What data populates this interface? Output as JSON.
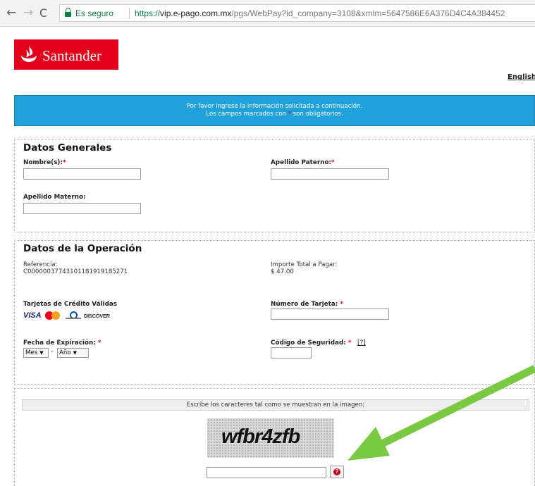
{
  "browser": {
    "secure_label": "Es seguro",
    "url_scheme": "https://",
    "url_host": "vip.e-pago.com.mx",
    "url_path": "/pgs/WebPay?id_company=3108&xmlm=5647586E6A376D4C4A384452"
  },
  "header": {
    "brand": "Santander",
    "language_link": "English"
  },
  "banner": {
    "line1": "Por favor ingrese la información solicitada a continuación.",
    "line2_before": "Los campos marcados con ",
    "line2_star": "*",
    "line2_after": " son obligatorios."
  },
  "general": {
    "title": "Datos Generales",
    "first_name_label": "Nombre(s):",
    "paternal_label": "Apellido Paterno:",
    "maternal_label": "Apellido Materno:",
    "required_mark": "*"
  },
  "operation": {
    "title": "Datos de la Operación",
    "reference_label": "Referencia:",
    "reference_value": "C0000003774310118191918527​1",
    "total_label": "Importe Total a Pagar:",
    "total_value": "$ 47.00",
    "cards_label": "Tarjetas de Crédito Válidas",
    "card_number_label": "Número de Tarjeta:",
    "expiry_label": "Fecha de Expiración:",
    "security_label": "Código de Seguridad:",
    "help_link": "[?]",
    "month_select": "Mes",
    "year_select": "Año",
    "separator": "-",
    "required_mark": "*",
    "card_logos": [
      "VISA",
      "MasterCard",
      "Diners Club",
      "DISCOVER"
    ]
  },
  "captcha": {
    "instruction": "Escribe los caracteres tal como se muestran en la imagen:",
    "image_text": "wfbr4zfb",
    "refresh_icon_glyph": "?"
  },
  "colors": {
    "brand_red": "#e2001a",
    "banner_blue": "#21a1da",
    "arrow_green": "#7ac943",
    "secure_green": "#0b8043"
  }
}
